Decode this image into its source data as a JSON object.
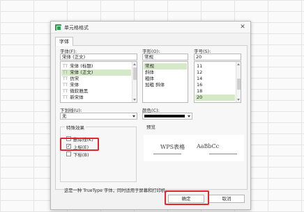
{
  "dialog": {
    "title": "单元格格式",
    "close": "✕",
    "tab": "字体"
  },
  "font": {
    "label": "字体(F):",
    "value": "宋体 (正文)",
    "items": [
      "宋体 (标题)",
      "宋体 (正文)",
      "仿宋",
      "宋体",
      "微软雅黑",
      "新宋体"
    ],
    "selected_index": 1,
    "icon": "TT"
  },
  "style": {
    "label": "字形(O):",
    "value": "常规",
    "items": [
      "常规",
      "斜体",
      "粗体",
      "加粗 斜体"
    ],
    "selected_index": 0
  },
  "size": {
    "label": "字号(S):",
    "value": "20",
    "items": [
      "11",
      "12",
      "14",
      "16",
      "18",
      "20"
    ],
    "selected_index": 5
  },
  "underline": {
    "label": "下划线(U):",
    "value": "无"
  },
  "color": {
    "label": "颜色(C):",
    "value": "#111111"
  },
  "effects": {
    "title": "特殊效果",
    "strikethrough": {
      "label": "删除线(K)",
      "checked": false
    },
    "superscript": {
      "label": "上标(E)",
      "checked": true
    },
    "subscript": {
      "label": "下标(B)",
      "checked": false
    },
    "check_mark": "✓"
  },
  "preview": {
    "title": "预览",
    "sample_cn": "WPS表格",
    "sample_en": "AaBbCc"
  },
  "description": "这是一种 TrueType 字体，同时适用于屏幕和打印机。",
  "buttons": {
    "ok": "确定",
    "cancel": "取消"
  },
  "accent_color": "#e3262b",
  "selection_color": "#d5e9c9"
}
